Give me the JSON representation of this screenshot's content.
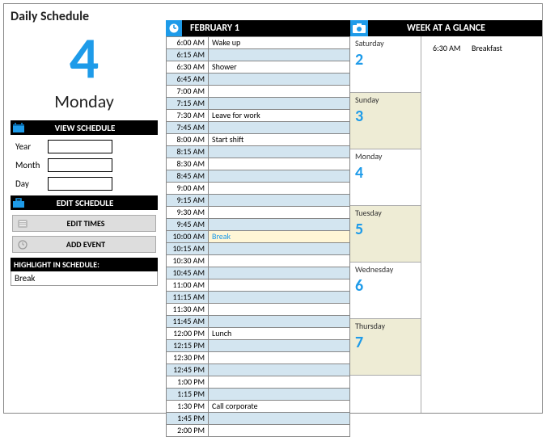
{
  "title": "Daily Schedule",
  "current": {
    "day_num": "4",
    "dow": "Monday"
  },
  "sections": {
    "view": "VIEW SCHEDULE",
    "edit": "EDIT SCHEDULE",
    "highlight": "HIGHLIGHT IN SCHEDULE:"
  },
  "form": {
    "year_label": "Year",
    "month_label": "Month",
    "day_label": "Day",
    "year_value": "",
    "month_value": "",
    "day_value": ""
  },
  "buttons": {
    "edit_times": "EDIT TIMES",
    "add_event": "ADD EVENT"
  },
  "highlight_value": "Break",
  "mid": {
    "date_label": "FEBRUARY 1",
    "rows": [
      {
        "time": "6:00 AM",
        "event": "Wake up",
        "alt": false
      },
      {
        "time": "6:15 AM",
        "event": "",
        "alt": true
      },
      {
        "time": "6:30 AM",
        "event": "Shower",
        "alt": false
      },
      {
        "time": "6:45 AM",
        "event": "",
        "alt": true
      },
      {
        "time": "7:00 AM",
        "event": "",
        "alt": false
      },
      {
        "time": "7:15 AM",
        "event": "",
        "alt": true
      },
      {
        "time": "7:30 AM",
        "event": "Leave for work",
        "alt": false
      },
      {
        "time": "7:45 AM",
        "event": "",
        "alt": true
      },
      {
        "time": "8:00 AM",
        "event": "Start shift",
        "alt": false
      },
      {
        "time": "8:15 AM",
        "event": "",
        "alt": true
      },
      {
        "time": "8:30 AM",
        "event": "",
        "alt": false
      },
      {
        "time": "8:45 AM",
        "event": "",
        "alt": true
      },
      {
        "time": "9:00 AM",
        "event": "",
        "alt": false
      },
      {
        "time": "9:15 AM",
        "event": "",
        "alt": true
      },
      {
        "time": "9:30 AM",
        "event": "",
        "alt": false
      },
      {
        "time": "9:45 AM",
        "event": "",
        "alt": true
      },
      {
        "time": "10:00 AM",
        "event": "Break",
        "alt": false,
        "hl": true
      },
      {
        "time": "10:15 AM",
        "event": "",
        "alt": true
      },
      {
        "time": "10:30 AM",
        "event": "",
        "alt": false
      },
      {
        "time": "10:45 AM",
        "event": "",
        "alt": true
      },
      {
        "time": "11:00 AM",
        "event": "",
        "alt": false
      },
      {
        "time": "11:15 AM",
        "event": "",
        "alt": true
      },
      {
        "time": "11:30 AM",
        "event": "",
        "alt": false
      },
      {
        "time": "11:45 AM",
        "event": "",
        "alt": true
      },
      {
        "time": "12:00 PM",
        "event": "Lunch",
        "alt": false
      },
      {
        "time": "12:15 PM",
        "event": "",
        "alt": true
      },
      {
        "time": "12:30 PM",
        "event": "",
        "alt": false
      },
      {
        "time": "12:45 PM",
        "event": "",
        "alt": true
      },
      {
        "time": "1:00 PM",
        "event": "",
        "alt": false
      },
      {
        "time": "1:15 PM",
        "event": "",
        "alt": true
      },
      {
        "time": "1:30 PM",
        "event": "Call corporate",
        "alt": false
      },
      {
        "time": "1:45 PM",
        "event": "",
        "alt": true
      },
      {
        "time": "2:00 PM",
        "event": "",
        "alt": false
      }
    ]
  },
  "right": {
    "title": "WEEK AT A GLANCE",
    "days": [
      {
        "name": "Saturday",
        "num": "2",
        "sel": false
      },
      {
        "name": "Sunday",
        "num": "3",
        "sel": true
      },
      {
        "name": "Monday",
        "num": "4",
        "sel": false
      },
      {
        "name": "Tuesday",
        "num": "5",
        "sel": true
      },
      {
        "name": "Wednesday",
        "num": "6",
        "sel": false
      },
      {
        "name": "Thursday",
        "num": "7",
        "sel": true
      }
    ],
    "event": {
      "time": "6:30 AM",
      "label": "Breakfast"
    }
  }
}
